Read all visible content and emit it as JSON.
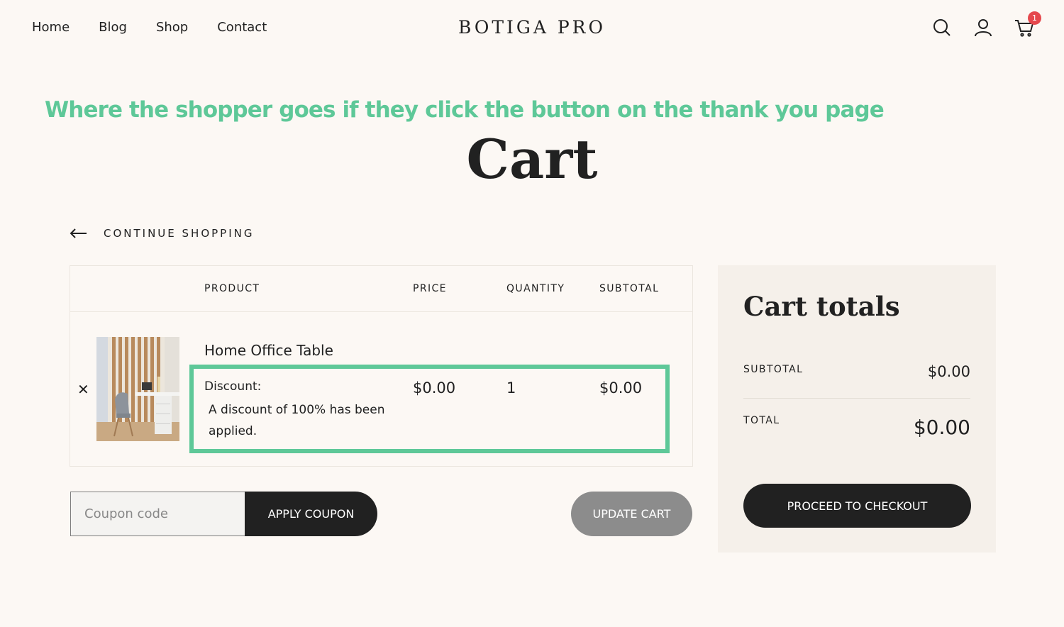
{
  "header": {
    "nav": [
      "Home",
      "Blog",
      "Shop",
      "Contact"
    ],
    "logo": "BOTIGA PRO",
    "cart_count": "1"
  },
  "annotation": "Where the shopper goes if they click the button on the thank you page",
  "page_title": "Cart",
  "continue_shopping": "CONTINUE SHOPPING",
  "cart_table": {
    "headers": [
      "PRODUCT",
      "PRICE",
      "QUANTITY",
      "SUBTOTAL"
    ],
    "row": {
      "product_name": "Home Office Table",
      "discount_label": "Discount:",
      "discount_text": "A discount of 100% has been applied.",
      "price": "$0.00",
      "quantity": "1",
      "subtotal": "$0.00"
    }
  },
  "coupon": {
    "placeholder": "Coupon code",
    "apply_label": "APPLY COUPON",
    "update_label": "UPDATE CART"
  },
  "totals": {
    "title": "Cart totals",
    "subtotal_label": "SUBTOTAL",
    "subtotal_value": "$0.00",
    "total_label": "TOTAL",
    "total_value": "$0.00",
    "checkout_label": "PROCEED TO CHECKOUT"
  },
  "colors": {
    "accent_green": "#5ec898",
    "dark": "#212121",
    "background": "#fcf8f4",
    "panel": "#f5f0ea",
    "badge": "#e5484d"
  }
}
